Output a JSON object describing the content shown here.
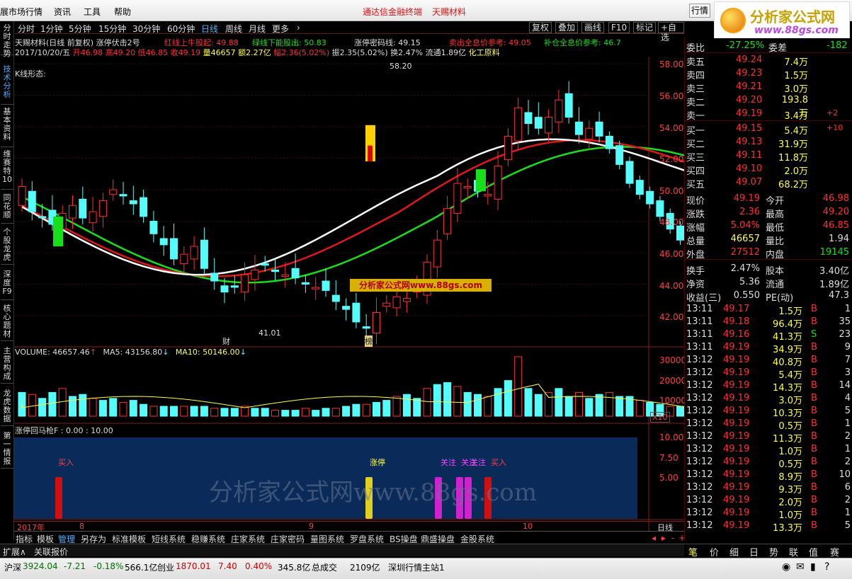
{
  "menu": {
    "items": [
      "展市场行情",
      "资讯",
      "工具",
      "帮助"
    ],
    "promo": [
      "通达信金融终端",
      "天赐材料"
    ],
    "quote_btn": "行情"
  },
  "logo": {
    "title": "分析家公式网",
    "url": "www.88gs.com"
  },
  "left_tabs": [
    "分时走势",
    "技术分析",
    "基本资料",
    "维赛特10",
    "同花顺",
    "个股龙虎",
    "深度F9",
    "核心题材",
    "主营构成",
    "龙虎数据",
    "第一情报"
  ],
  "periods": [
    "分时",
    "1分钟",
    "5分钟",
    "15分钟",
    "30分钟",
    "60分钟",
    "日线",
    "周线",
    "月线",
    "更多"
  ],
  "selected_period": "日线",
  "right_buttons": [
    "复权",
    "叠加",
    "画线",
    "F10",
    "标记",
    "+自选"
  ],
  "chart_info": {
    "title": "天赐材料(日线 前复权) 涨停伏击2号",
    "red_up": "红线上牛股起: 49.88",
    "green_down": "绿线下能股出: 50.83",
    "zt_code": "涨停密码线: 49.15",
    "sell_ref": "卖出全息价参考: 49.05",
    "buy_ref": "补仓全息价参考: 46.7",
    "date": "2017/10/20/五",
    "open": "开46.98",
    "high": "高49.20",
    "low": "低46.85",
    "close": "收49.19",
    "vol": "量46657",
    "amt": "额2.27亿",
    "amp": "幅2.36(5.02%)",
    "swing": "振2.35(5.02%)",
    "turnover": "换2.47%",
    "float": "流通1.89亿",
    "industry": "化工原料",
    "kform": "K线形态:",
    "high_label": "58.20",
    "low_label": "41.01",
    "cai": "财",
    "bang": "榜"
  },
  "y_axis": [
    "58.00",
    "56.00",
    "54.00",
    "52.00",
    "50.00",
    "48.00",
    "46.00",
    "44.00",
    "42.00"
  ],
  "volume_info": {
    "vol": "VOLUME: 46657.46",
    "ma5": "MA5: 43156.80",
    "ma10": "MA10: 50146.00",
    "axis": [
      "30000",
      "20000",
      "10000"
    ],
    "x10": "X10"
  },
  "indicator": {
    "title": "涨停回马枪F  : 0.00 : 10.00",
    "axis": [
      "10.00",
      "7.50",
      "5.00"
    ],
    "labels": [
      "买入",
      "涨停",
      "关注",
      "关注",
      "关注",
      "买入"
    ]
  },
  "watermark": {
    "banner": "分析家公式网www.88gs.com",
    "big": "分析家公式网www.88gs.com"
  },
  "x_axis": {
    "year": "2017年",
    "m8": "8",
    "m9": "9",
    "m10": "10",
    "period": "日线"
  },
  "bottom_tabs": [
    "指标",
    "模板",
    "管理",
    "另存为",
    "标准模板",
    "短线系统",
    "稳赚系统",
    "庄家系统",
    "庄家密码",
    "量图系统",
    "罗盘系统",
    "BS操盘",
    "鼎盛操盘",
    "金股系统"
  ],
  "ext": [
    "扩展∧",
    "关联报价"
  ],
  "order_book": {
    "wb": {
      "label": "委比",
      "val": "-27.25%",
      "label2": "委差",
      "val2": "-182"
    },
    "sells": [
      {
        "l": "卖五",
        "p": "49.24",
        "v": "7.4万",
        "c": ""
      },
      {
        "l": "卖四",
        "p": "49.23",
        "v": "1.5万",
        "c": ""
      },
      {
        "l": "卖三",
        "p": "49.21",
        "v": "3.0万",
        "c": ""
      },
      {
        "l": "卖二",
        "p": "49.20",
        "v": "193.8万",
        "c": ""
      },
      {
        "l": "卖一",
        "p": "49.19",
        "v": "3.4万",
        "c": "+2"
      }
    ],
    "buys": [
      {
        "l": "买一",
        "p": "49.15",
        "v": "5.4万",
        "c": "+10"
      },
      {
        "l": "买二",
        "p": "49.13",
        "v": "31.9万",
        "c": ""
      },
      {
        "l": "买三",
        "p": "49.11",
        "v": "11.8万",
        "c": ""
      },
      {
        "l": "买四",
        "p": "49.10",
        "v": "2.0万",
        "c": ""
      },
      {
        "l": "买五",
        "p": "49.07",
        "v": "68.2万",
        "c": ""
      }
    ]
  },
  "quote": [
    {
      "l1": "现价",
      "v1": "49.19",
      "l2": "今开",
      "v2": "46.98"
    },
    {
      "l1": "涨跌",
      "v1": "2.36",
      "l2": "最高",
      "v2": "49.20"
    },
    {
      "l1": "涨幅",
      "v1": "5.04%",
      "l2": "最低",
      "v2": "46.85"
    },
    {
      "l1": "总量",
      "v1": "46657",
      "l2": "量比",
      "v2": "1.94"
    },
    {
      "l1": "外盘",
      "v1": "27512",
      "l2": "内盘",
      "v2": "19145"
    },
    {
      "l1": "换手",
      "v1": "2.47%",
      "l2": "股本",
      "v2": "3.40亿"
    },
    {
      "l1": "净资",
      "v1": "5.36",
      "l2": "流通",
      "v2": "1.89亿"
    },
    {
      "l1": "收益(三)",
      "v1": "0.550",
      "l2": "PE(动)",
      "v2": "47.3"
    }
  ],
  "ticks": [
    {
      "t": "13:11",
      "p": "49.17",
      "v": "1.5万",
      "s": "B",
      "n": "1"
    },
    {
      "t": "13:11",
      "p": "49.18",
      "v": "96.4万",
      "s": "B",
      "n": "35"
    },
    {
      "t": "13:11",
      "p": "49.16",
      "v": "41.3万",
      "s": "S",
      "n": "23"
    },
    {
      "t": "13:11",
      "p": "49.19",
      "v": "34.9万",
      "s": "B",
      "n": "9"
    },
    {
      "t": "13:12",
      "p": "49.19",
      "v": "40.8万",
      "s": "B",
      "n": "7"
    },
    {
      "t": "13:12",
      "p": "49.19",
      "v": "5.4万",
      "s": "B",
      "n": "3"
    },
    {
      "t": "13:12",
      "p": "49.19",
      "v": "14.3万",
      "s": "B",
      "n": "14"
    },
    {
      "t": "13:12",
      "p": "49.19",
      "v": "3.0万",
      "s": "B",
      "n": "4"
    },
    {
      "t": "13:12",
      "p": "49.19",
      "v": "10.3万",
      "s": "B",
      "n": "5"
    },
    {
      "t": "13:12",
      "p": "49.19",
      "v": "0.5万",
      "s": "B",
      "n": "1"
    },
    {
      "t": "13:12",
      "p": "49.19",
      "v": "11.3万",
      "s": "B",
      "n": "2"
    },
    {
      "t": "13:12",
      "p": "49.19",
      "v": "1.0万",
      "s": "B",
      "n": "1"
    },
    {
      "t": "13:12",
      "p": "49.19",
      "v": "0.5万",
      "s": "B",
      "n": "2"
    },
    {
      "t": "13:12",
      "p": "49.19",
      "v": "8.9万",
      "s": "B",
      "n": "10"
    },
    {
      "t": "13:12",
      "p": "49.19",
      "v": "9.3万",
      "s": "B",
      "n": "6"
    },
    {
      "t": "13:12",
      "p": "49.19",
      "v": "2.0万",
      "s": "B",
      "n": "2"
    },
    {
      "t": "13:12",
      "p": "49.19",
      "v": "1.0万",
      "s": "B",
      "n": "1"
    },
    {
      "t": "13:12",
      "p": "49.19",
      "v": "13.3万",
      "s": "B",
      "n": "5"
    }
  ],
  "right_tabs": [
    "笔",
    "价",
    "细",
    "日",
    "势",
    "联",
    "值",
    "赛"
  ],
  "status": {
    "sh": "沪深",
    "sh_idx": "3924.04",
    "sh_chg": "-7.21",
    "sh_pct": "-0.18%",
    "sh_amt": "566.1亿",
    "cy": "创业",
    "cy_idx": "1870.01",
    "cy_chg": "7.40",
    "cy_pct": "0.40%",
    "cy_amt": "345.8亿",
    "total": "总成交",
    "total_amt": "2109亿",
    "server": "深圳行情主站1"
  },
  "colors": {
    "up": "#ff3030",
    "down": "#54fcfc",
    "ma_white": "#ffffff",
    "ma_red": "#e01818",
    "ma_green": "#18e018",
    "indicator_bg": "#0a2a5a"
  }
}
